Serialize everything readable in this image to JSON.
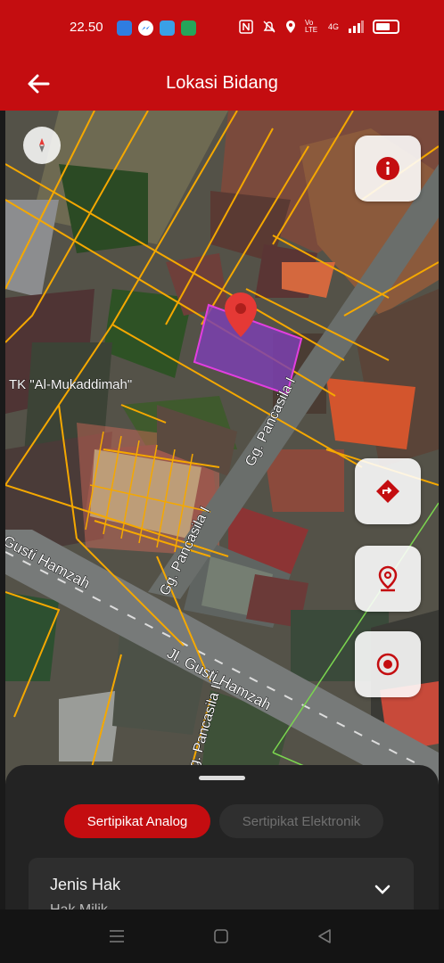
{
  "status_bar": {
    "time": "22.50",
    "app_icons": [
      "app-icon-blue",
      "messenger-icon",
      "app-icon-bird",
      "shield-app-icon"
    ],
    "right_icons": [
      "nfc-icon",
      "mute-icon",
      "location-icon",
      "volte-icon",
      "4g-icon",
      "signal-icon",
      "battery-icon"
    ],
    "volte_text": "Vo LTE",
    "net_text": "4G"
  },
  "app_bar": {
    "title": "Lokasi Bidang",
    "back_icon": "arrow-left-icon",
    "color": "#c40d10"
  },
  "map": {
    "labels": {
      "school": "TK \"Al-Mukaddimah\"",
      "lane_1": "Gg. Pancasila I",
      "lane_2": "Gg. Pancasila I",
      "lane_3": "Gg. Pancasila II",
      "road_1": "Jl. Gusti Hamzah",
      "road_2": "Gusti Hamzah"
    },
    "parcel_color": "#7b3fb0",
    "boundary_color": "#f5a800",
    "marker_color": "#e53935"
  },
  "map_buttons": {
    "compass": "compass-icon",
    "info": "info-icon",
    "directions": "directions-icon",
    "location_pin": "location-pin-icon",
    "my_location": "my-location-icon"
  },
  "bottom_sheet": {
    "tab_active": "Sertipikat Analog",
    "tab_inactive": "Sertipikat Elektronik",
    "field_label": "Jenis Hak",
    "field_value": "Hak Milik"
  },
  "nav_bar": {
    "buttons": [
      "menu-icon",
      "home-icon",
      "back-icon"
    ]
  }
}
